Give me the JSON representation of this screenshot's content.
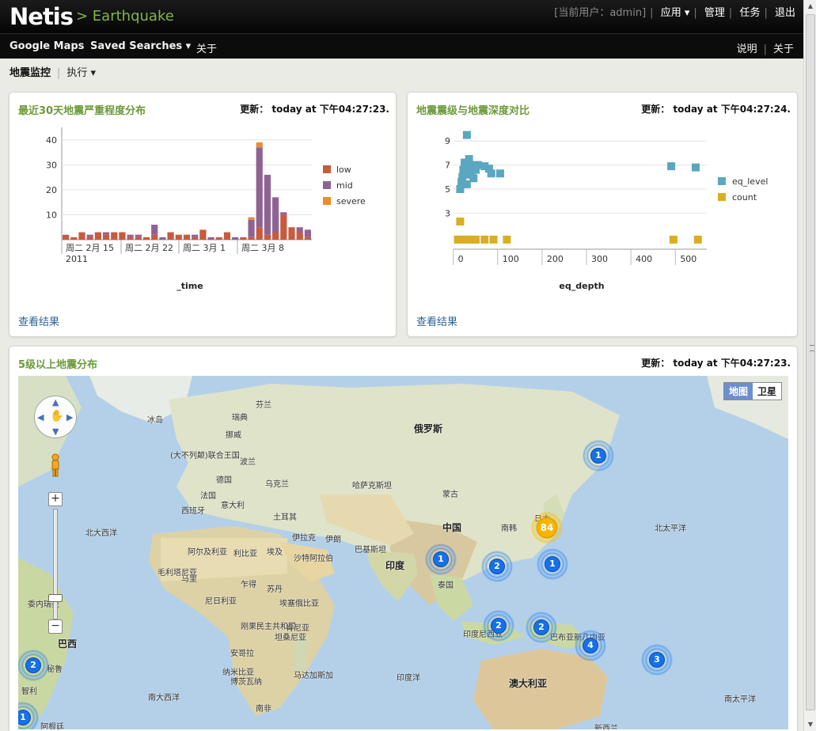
{
  "header": {
    "logo": "Netis",
    "app_name": "> Earthquake",
    "current_user": "[当前用户：admin]",
    "links": [
      "应用 ▾",
      "管理",
      "任务",
      "退出"
    ]
  },
  "nav": {
    "items": [
      "Google Maps",
      "Saved Searches ▾",
      "关于"
    ],
    "right": [
      "说明",
      "关于"
    ]
  },
  "appbar": {
    "title": "地震监控",
    "menu": "执行 ▾"
  },
  "panels": {
    "severity": {
      "title": "最近30天地震严重程度分布",
      "updated": "更新： today at 下午04:27:23.",
      "view_link": "查看结果"
    },
    "level_depth": {
      "title": "地震震级与地震深度对比",
      "updated": "更新： today at 下午04:27:24.",
      "view_link": "查看结果"
    },
    "map": {
      "title": "5级以上地震分布",
      "updated": "更新： today at 下午04:27:23.",
      "map_type": [
        "地图",
        "卫星"
      ]
    }
  },
  "map_labels": [
    {
      "t": "芬兰"
    },
    {
      "t": "冰岛"
    },
    {
      "t": "瑞典"
    },
    {
      "t": "挪威"
    },
    {
      "t": "俄罗斯"
    },
    {
      "t": "(大不列颠)联合王国"
    },
    {
      "t": "波兰"
    },
    {
      "t": "德国"
    },
    {
      "t": "乌克兰"
    },
    {
      "t": "哈萨克斯坦"
    },
    {
      "t": "法国"
    },
    {
      "t": "蒙古"
    },
    {
      "t": "西班牙"
    },
    {
      "t": "意大利"
    },
    {
      "t": "土耳其"
    },
    {
      "t": "中国"
    },
    {
      "t": "北大西洋"
    },
    {
      "t": "伊拉克"
    },
    {
      "t": "伊朗"
    },
    {
      "t": "南韩"
    },
    {
      "t": "日本"
    },
    {
      "t": "北太平洋"
    },
    {
      "t": "阿尔及利亚"
    },
    {
      "t": "利比亚"
    },
    {
      "t": "埃及"
    },
    {
      "t": "巴基斯坦"
    },
    {
      "t": "沙特阿拉伯"
    },
    {
      "t": "印度"
    },
    {
      "t": "毛利塔尼亚"
    },
    {
      "t": "马里"
    },
    {
      "t": "乍得"
    },
    {
      "t": "苏丹"
    },
    {
      "t": "泰国"
    },
    {
      "t": "尼日利亚"
    },
    {
      "t": "埃塞俄比亚"
    },
    {
      "t": "刚果民主共和国"
    },
    {
      "t": "肯尼亚"
    },
    {
      "t": "坦桑尼亚"
    },
    {
      "t": "印度尼西亚"
    },
    {
      "t": "巴布亚新几内亚"
    },
    {
      "t": "安哥拉"
    },
    {
      "t": "纳米比亚"
    },
    {
      "t": "博茨瓦纳"
    },
    {
      "t": "马达加斯加"
    },
    {
      "t": "印度洋"
    },
    {
      "t": "澳大利亚"
    },
    {
      "t": "巴西"
    },
    {
      "t": "秘鲁"
    },
    {
      "t": "智利"
    },
    {
      "t": "阿根廷"
    },
    {
      "t": "南大西洋"
    },
    {
      "t": "南非"
    },
    {
      "t": "南太平洋"
    },
    {
      "t": "新西兰"
    },
    {
      "t": "委内瑞拉"
    }
  ],
  "clusters": [
    {
      "n": "1"
    },
    {
      "n": "84",
      "style": "yellow"
    },
    {
      "n": "1"
    },
    {
      "n": "2"
    },
    {
      "n": "1"
    },
    {
      "n": "2"
    },
    {
      "n": "2"
    },
    {
      "n": "4"
    },
    {
      "n": "3"
    },
    {
      "n": "2"
    },
    {
      "n": "1"
    }
  ],
  "chart_data": [
    {
      "type": "bar",
      "title": "最近30天地震严重程度分布",
      "xlabel": "_time",
      "ylabel": "",
      "ylim": [
        0,
        45
      ],
      "yticks": [
        10,
        20,
        30,
        40
      ],
      "x_tick_labels": [
        "周二 2月 15\n2011",
        "周二 2月 22",
        "周二 3月 1",
        "周二 3月 8"
      ],
      "legend": "right",
      "colors": {
        "low": "#c85a3d",
        "mid": "#8e6394",
        "severe": "#ec8c2f"
      },
      "categories": [
        "d1",
        "d2",
        "d3",
        "d4",
        "d5",
        "d6",
        "d7",
        "d8",
        "d9",
        "d10",
        "d11",
        "d12",
        "d13",
        "d14",
        "d15",
        "d16",
        "d17",
        "d18",
        "d19",
        "d20",
        "d21",
        "d22",
        "d23",
        "d24",
        "d25",
        "d26",
        "d27",
        "d28",
        "d29",
        "d30",
        "d31"
      ],
      "series": [
        {
          "name": "low",
          "values": [
            2,
            1,
            3,
            1,
            3,
            2,
            3,
            3,
            1,
            1,
            1,
            2,
            0,
            3,
            2,
            2,
            1,
            4,
            0,
            1,
            3,
            0,
            1,
            1,
            5,
            2,
            3,
            10,
            5,
            3,
            1
          ]
        },
        {
          "name": "mid",
          "values": [
            0,
            0,
            0,
            1,
            0,
            1,
            0,
            0,
            1,
            1,
            0,
            4,
            1,
            0,
            0,
            0,
            1,
            0,
            1,
            0,
            0,
            1,
            0,
            7,
            32,
            24,
            14,
            1,
            0,
            2,
            3
          ]
        },
        {
          "name": "severe",
          "values": [
            0,
            0,
            0,
            0,
            0,
            0,
            0,
            0,
            0,
            0,
            0,
            0,
            0,
            0,
            0,
            0,
            0,
            0,
            0,
            0,
            0,
            0,
            0,
            1,
            2,
            0,
            0,
            0,
            0,
            0,
            0
          ]
        }
      ]
    },
    {
      "type": "bar",
      "title": "地震震级与地震深度对比",
      "xlabel": "eq_depth",
      "ylabel": "",
      "xlim": [
        -10,
        560
      ],
      "ylim": [
        0,
        10
      ],
      "xticks": [
        0,
        100,
        200,
        300,
        400,
        500
      ],
      "yticks": [
        3,
        5,
        7,
        9
      ],
      "legend": "right",
      "colors": {
        "eq_level": "#5ba6c0",
        "count": "#d9ae22"
      },
      "series": [
        {
          "name": "eq_level",
          "x": [
            5,
            8,
            10,
            12,
            15,
            18,
            20,
            22,
            25,
            28,
            30,
            35,
            40,
            45,
            60,
            70,
            75,
            95,
            480,
            535,
            20
          ],
          "y": [
            5.0,
            5.6,
            6.0,
            6.6,
            7.2,
            6.2,
            5.4,
            6.8,
            7.5,
            7.0,
            6.3,
            5.9,
            6.6,
            7.0,
            6.9,
            6.7,
            6.3,
            6.3,
            6.9,
            6.8,
            9.5
          ]
        },
        {
          "name": "count",
          "x": [
            0,
            10,
            20,
            30,
            40,
            60,
            80,
            110,
            485,
            540,
            5
          ],
          "y": [
            0.8,
            0.8,
            0.8,
            0.8,
            0.8,
            0.8,
            0.8,
            0.8,
            0.8,
            0.8,
            2.3
          ]
        }
      ]
    }
  ]
}
